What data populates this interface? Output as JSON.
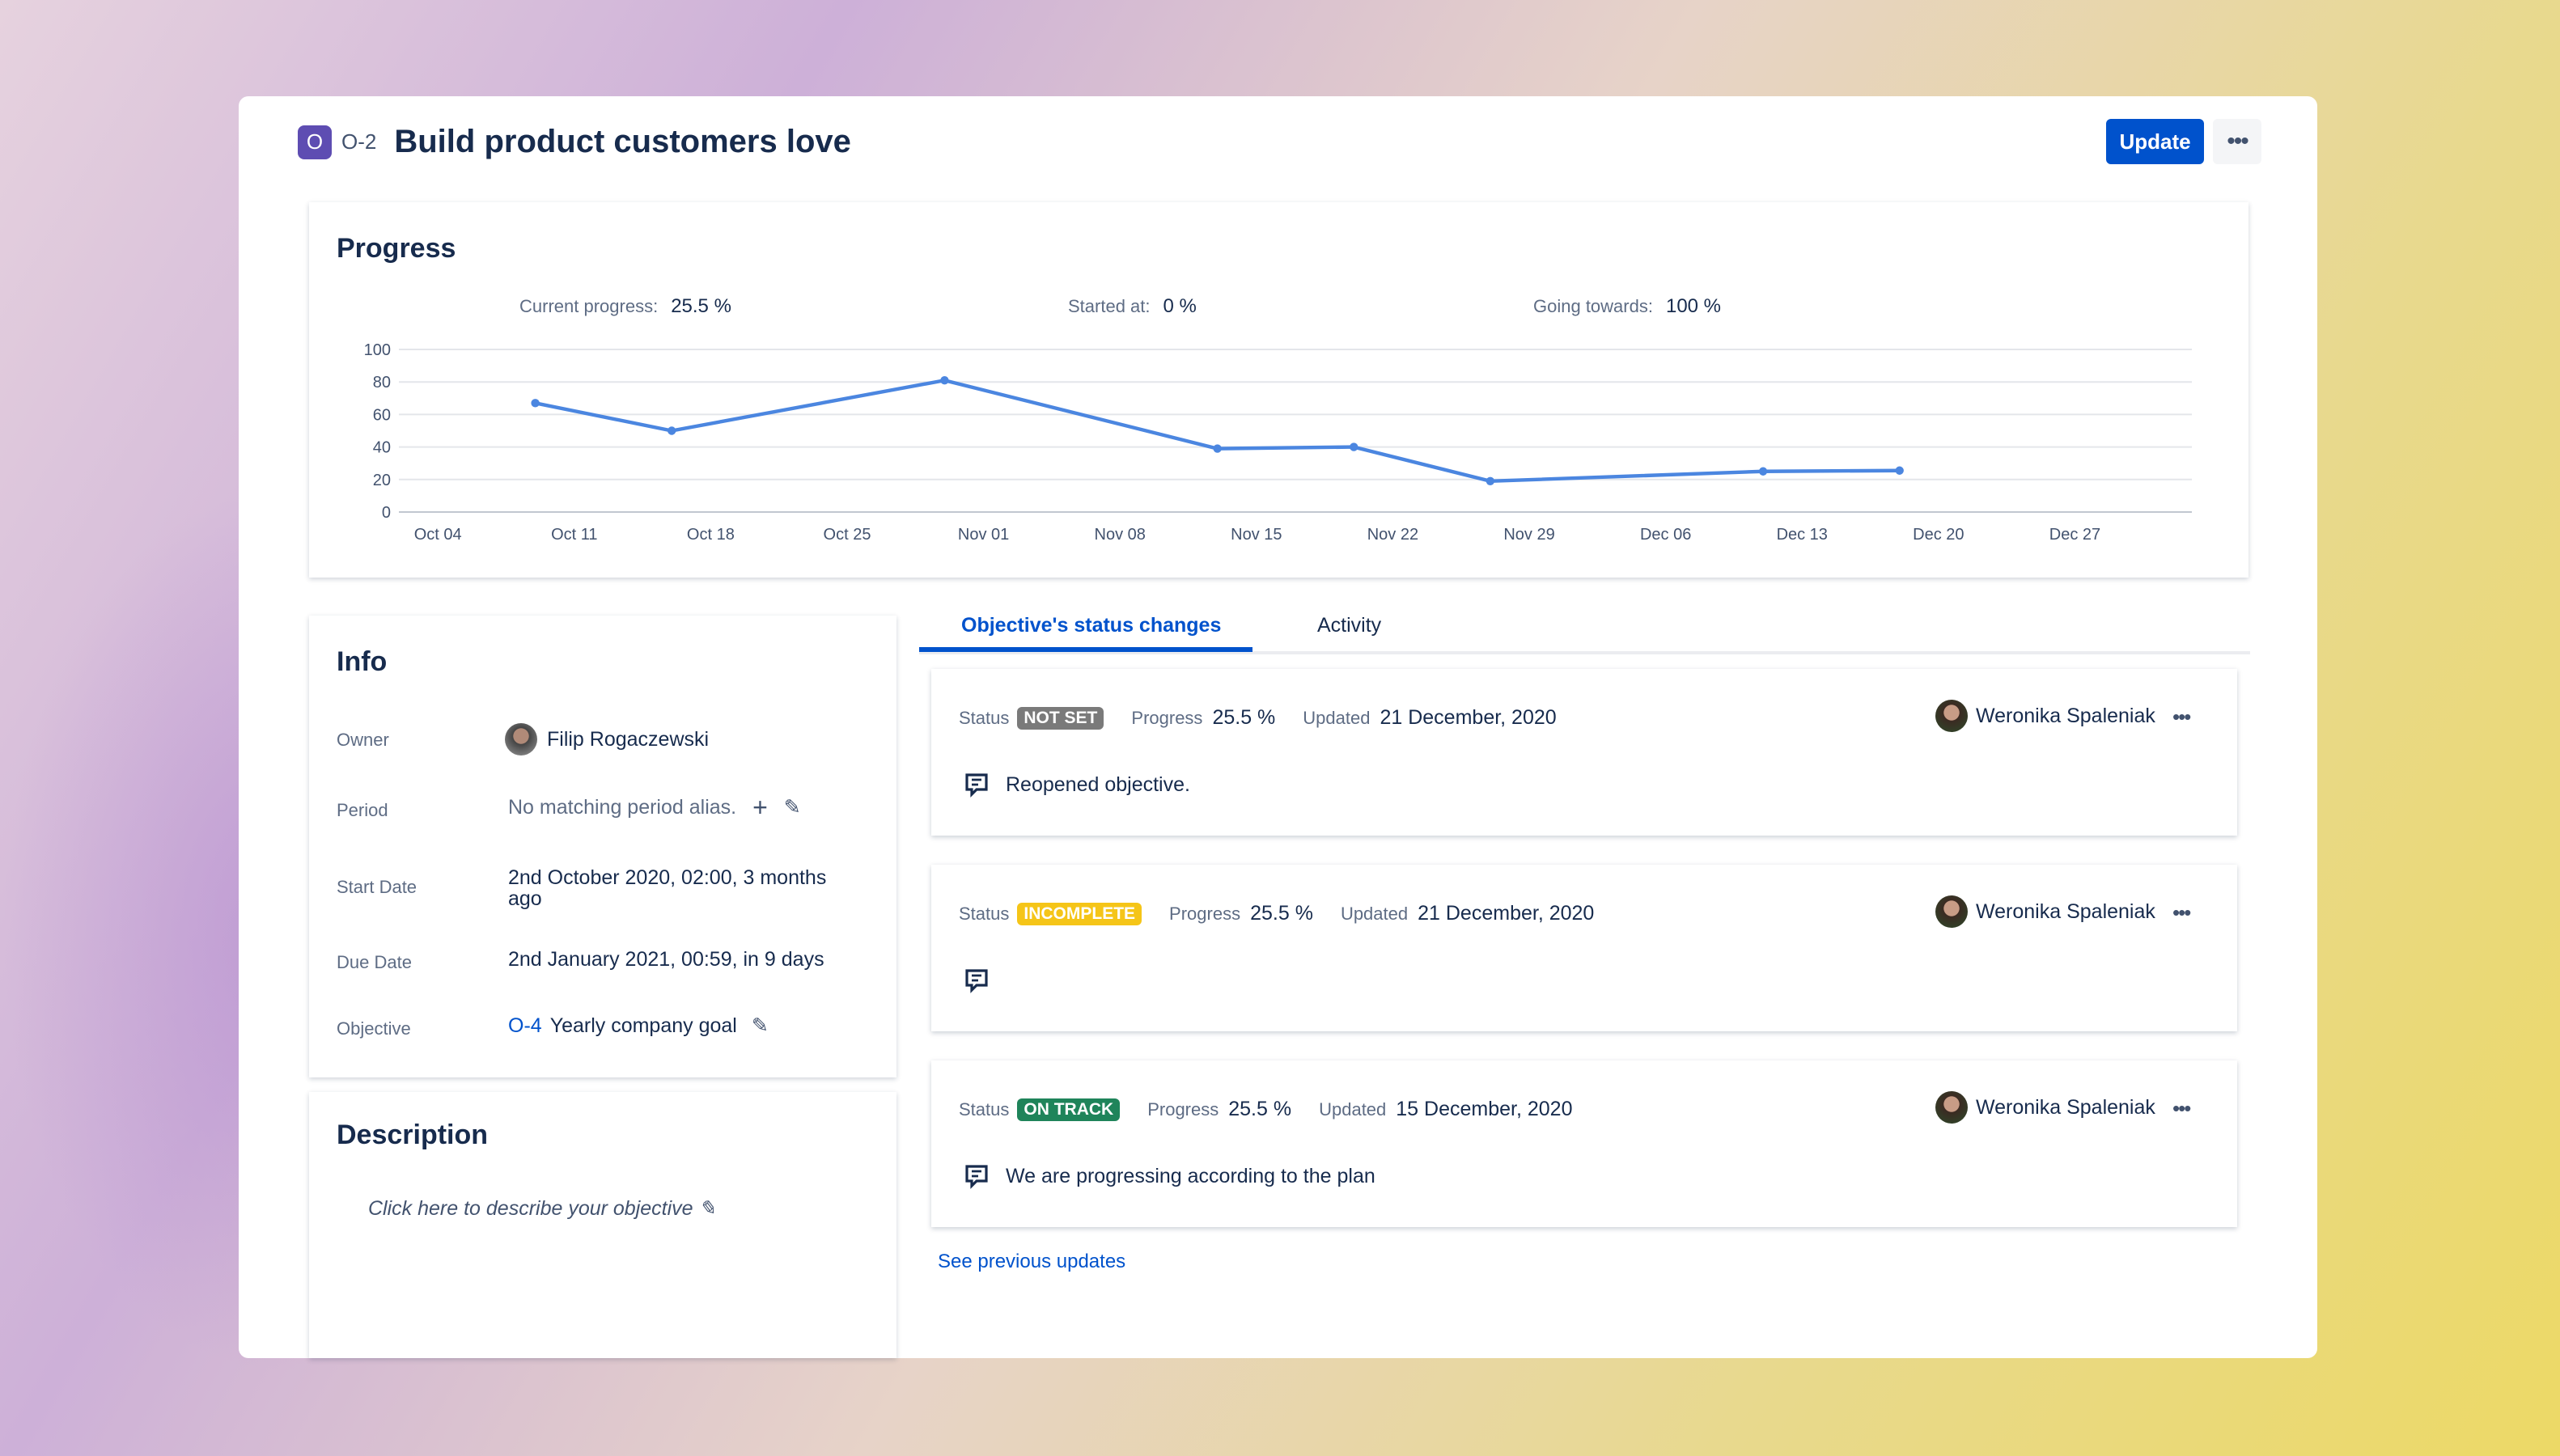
{
  "header": {
    "badge": "O",
    "key": "O-2",
    "title": "Build product customers love",
    "update_label": "Update",
    "more_label": "•••"
  },
  "progress": {
    "title": "Progress",
    "current_label": "Current progress:",
    "current_value": "25.5 %",
    "started_label": "Started at:",
    "started_value": "0 %",
    "towards_label": "Going towards:",
    "towards_value": "100 %"
  },
  "chart_data": {
    "type": "line",
    "x": [
      "2020-10-09",
      "2020-10-16",
      "2020-10-30",
      "2020-11-13",
      "2020-11-20",
      "2020-11-27",
      "2020-12-11",
      "2020-12-18"
    ],
    "values": [
      67,
      50,
      81,
      39,
      40,
      19,
      25,
      25.5
    ],
    "ylim": [
      0,
      100
    ],
    "yticks": [
      0,
      20,
      40,
      60,
      80,
      100
    ],
    "xticks": [
      "Oct 04",
      "Oct 11",
      "Oct 18",
      "Oct 25",
      "Nov 01",
      "Nov 08",
      "Nov 15",
      "Nov 22",
      "Nov 29",
      "Dec 06",
      "Dec 13",
      "Dec 20",
      "Dec 27"
    ],
    "xlim": [
      "2020-10-02",
      "2021-01-02"
    ],
    "grid": true,
    "color": "#4b86e0"
  },
  "info": {
    "title": "Info",
    "owner_label": "Owner",
    "owner": "Filip Rogaczewski",
    "period_label": "Period",
    "period": "No matching period alias.",
    "start_label": "Start Date",
    "start": "2nd October 2020, 02:00, 3 months ago",
    "due_label": "Due Date",
    "due": "2nd January 2021, 00:59, in 9 days",
    "objective_label": "Objective",
    "objective_key": "O-4",
    "objective": "Yearly company goal"
  },
  "description": {
    "title": "Description",
    "placeholder": "Click here to describe your objective"
  },
  "tabs": [
    {
      "label": "Objective's status changes"
    },
    {
      "label": "Activity"
    }
  ],
  "updates": [
    {
      "status_label": "Status",
      "status": "NOT SET",
      "status_color": "#7a7a7a",
      "progress_label": "Progress",
      "progress": "25.5 %",
      "updated_label": "Updated",
      "updated": "21 December, 2020",
      "user": "Weronika Spaleniak",
      "comment": "Reopened objective."
    },
    {
      "status_label": "Status",
      "status": "INCOMPLETE",
      "status_color": "#f5c518",
      "progress_label": "Progress",
      "progress": "25.5 %",
      "updated_label": "Updated",
      "updated": "21 December, 2020",
      "user": "Weronika Spaleniak",
      "comment": ""
    },
    {
      "status_label": "Status",
      "status": "ON TRACK",
      "status_color": "#1f845a",
      "progress_label": "Progress",
      "progress": "25.5 %",
      "updated_label": "Updated",
      "updated": "15 December, 2020",
      "user": "Weronika Spaleniak",
      "comment": "We are progressing according to the plan"
    }
  ],
  "see_previous": "See previous updates"
}
